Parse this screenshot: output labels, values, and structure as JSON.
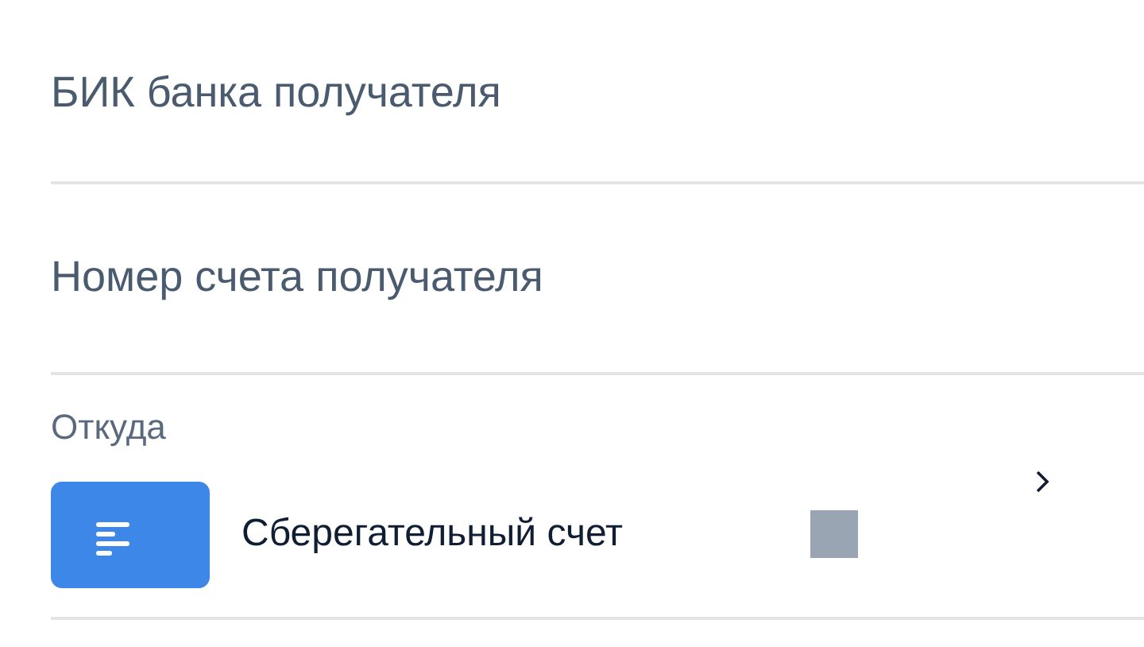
{
  "fields": [
    {
      "placeholder": "БИК банка получателя"
    },
    {
      "placeholder": "Номер счета получателя"
    }
  ],
  "source": {
    "label": "Откуда",
    "account": {
      "name": "Сберегательный счет"
    }
  }
}
